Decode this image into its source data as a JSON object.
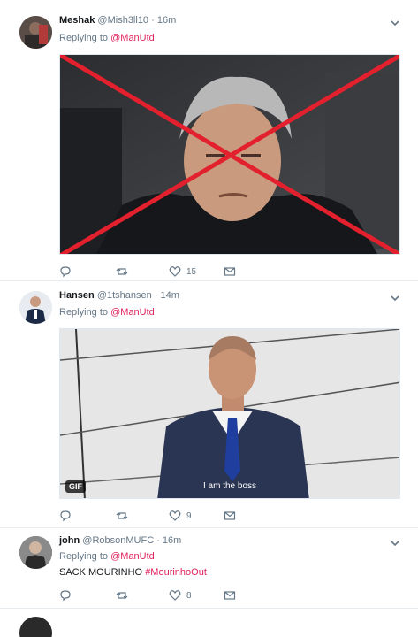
{
  "tweets": [
    {
      "name": "Meshak",
      "handle": "@Mish3ll10",
      "time": "· 16m",
      "reply_prefix": "Replying to",
      "reply_to": "@ManUtd",
      "reply_count": "",
      "retweet_count": "",
      "like_count": "15"
    },
    {
      "name": "Hansen",
      "handle": "@1tshansen",
      "time": "· 14m",
      "reply_prefix": "Replying to",
      "reply_to": "@ManUtd",
      "gif_label": "GIF",
      "gif_caption": "I am the boss",
      "like_count": "9"
    },
    {
      "name": "john",
      "handle": "@RobsonMUFC",
      "time": "· 16m",
      "reply_prefix": "Replying to",
      "reply_to": "@ManUtd",
      "text": "SACK MOURINHO",
      "hashtag": "#MourinhoOut",
      "like_count": "8"
    }
  ],
  "colors": {
    "accent": "#e0245e",
    "muted": "#657786",
    "cross": "#e3202d"
  },
  "icons": [
    "reply-icon",
    "retweet-icon",
    "like-icon",
    "message-icon",
    "chevron-down-icon"
  ]
}
